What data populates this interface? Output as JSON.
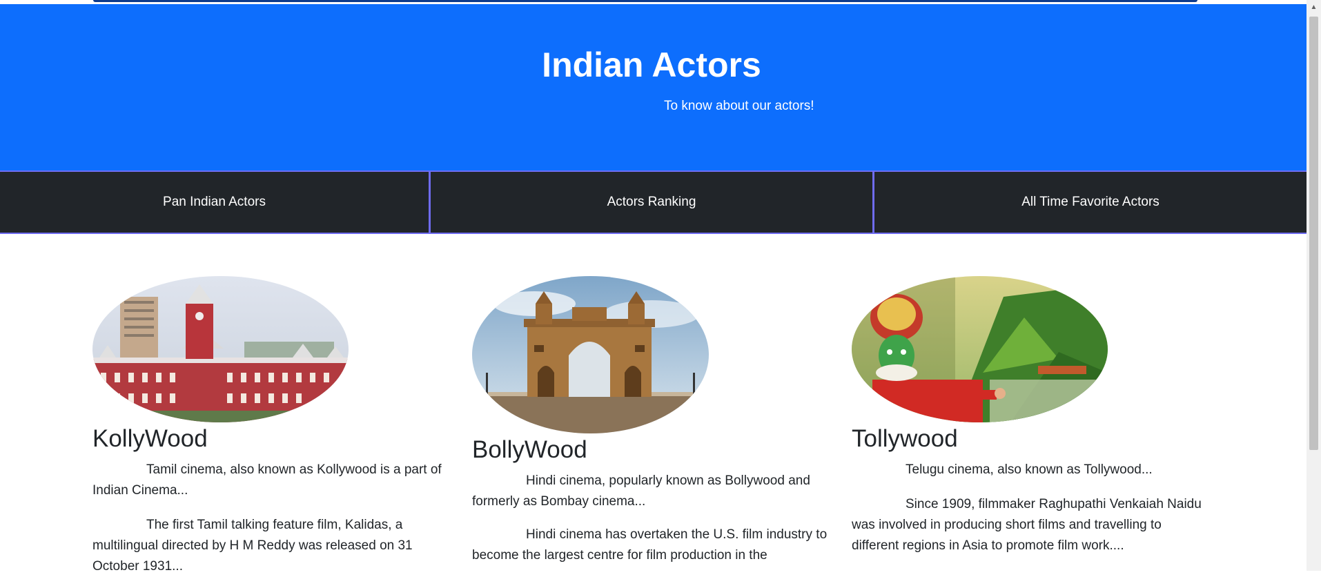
{
  "header": {
    "title": "Indian Actors",
    "subtitle": "To know about our actors!"
  },
  "nav": {
    "items": [
      {
        "label": "Pan Indian Actors"
      },
      {
        "label": "Actors Ranking"
      },
      {
        "label": "All Time Favorite Actors"
      }
    ]
  },
  "cards": [
    {
      "heading": "KollyWood",
      "image": "chennai-central-station-image",
      "paragraphs": [
        "Tamil cinema, also known as Kollywood is a part of Indian Cinema...",
        "The first Tamil talking feature film, Kalidas, a multilingual directed by H M Reddy was released on 31 October 1931..."
      ]
    },
    {
      "heading": "BollyWood",
      "image": "gateway-of-india-image",
      "paragraphs": [
        "Hindi cinema, popularly known as Bollywood and formerly as Bombay cinema...",
        "Hindi cinema has overtaken the U.S. film industry to become the largest centre for film production in the"
      ]
    },
    {
      "heading": "Tollywood",
      "image": "kathakali-dancer-image",
      "paragraphs": [
        "Telugu cinema, also known as Tollywood...",
        "Since 1909, filmmaker Raghupathi Venkaiah Naidu was involved in producing short films and travelling to different regions in Asia to promote film work...."
      ]
    }
  ],
  "colors": {
    "hero_bg": "#0d6efd",
    "nav_bg": "#212529",
    "nav_border": "#6f6cf0"
  }
}
